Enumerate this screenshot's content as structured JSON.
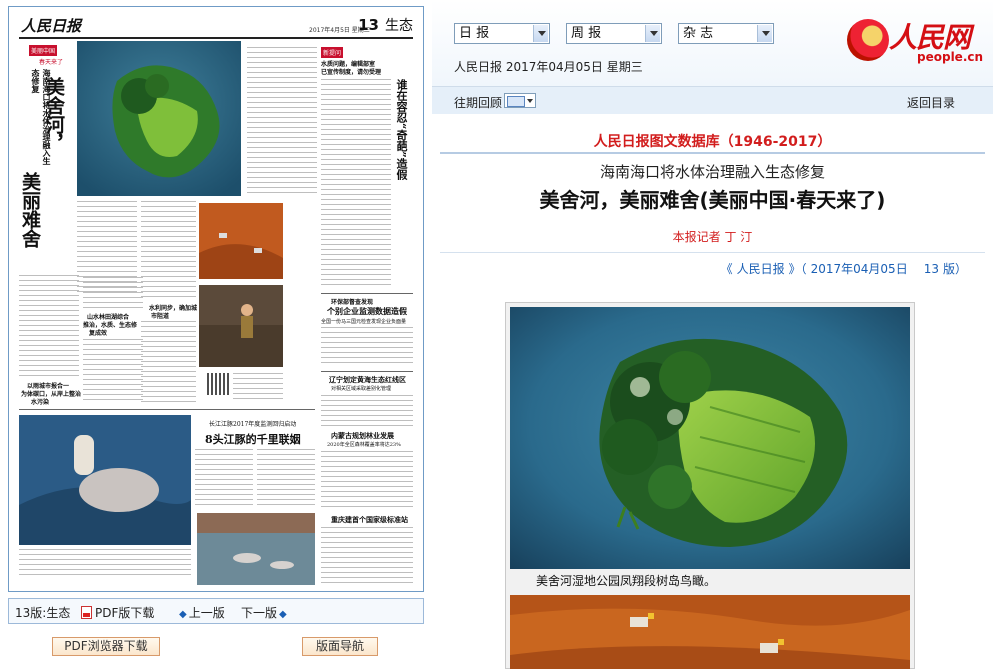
{
  "left": {
    "paper": {
      "logo": "人民日报",
      "date_line": "2017年4月5日 星期三",
      "page_no": "13",
      "section": "生态",
      "tag_top": "美丽中国",
      "tag_sub": "春天来了",
      "kicker": "海南海口将水体治理融入生态修复",
      "headline_v1": "美舍河，",
      "headline_v2": "美丽难舍",
      "right_col_tag": "新提问",
      "right_vhead": "谁在容忍“奇葩”造假",
      "sub1": "水质问题，编辑部室",
      "sub2": "已宣传制度，请勿受理",
      "mid_tag": "环保部督查发现",
      "mid_h": "个别企业监测数据造假",
      "mid_sub": "全国一份马三国元检查发现企业负面量",
      "liaoning_h": "辽宁划定黄海生态红线区",
      "liaoning_sub": "对相关区域采取差别化管理",
      "river_h1": "水利同步，确加城",
      "river_h2": "市阻道",
      "dolphin_kicker": "长江江豚2017年度监测回归启动",
      "dolphin_h": "8头江豚的千里联姻",
      "nm_h": "内蒙古规划林业发展",
      "nm_sub": "2020年全区森林覆盖率将达23%",
      "cq_h": "重庆建首个国家级标准站",
      "left_h1": "以雨城市报合一",
      "left_h2": "为体碳口，从岸上整治",
      "left_h3": "水污染",
      "left_h4": "山水林田湖综合",
      "left_h5": "推治，水质、生态修",
      "left_h6": "复成效"
    },
    "toolbar": {
      "page_label": "13版:生态",
      "pdf_label": "PDF版下载",
      "prev_label": "上一版",
      "next_label": "下一版"
    },
    "buttons": {
      "pdf_browser": "PDF浏览器下载",
      "page_nav": "版面导航"
    }
  },
  "right": {
    "selects": {
      "daily": "日 报",
      "weekly": "周 报",
      "magazine": "杂 志"
    },
    "pub_line": "人民日报 2017年04月05日 星期三",
    "logo": {
      "cn": "人民网",
      "en": "people.cn"
    },
    "nav": {
      "past_label": "往期回顾",
      "back_label": "返回目录"
    },
    "article": {
      "db_title": "人民日报图文数据库（1946-2017）",
      "subtitle": "海南海口将水体治理融入生态修复",
      "headline": "美舍河，美丽难舍(美丽中国·春天来了)",
      "byline": "本报记者 丁 汀",
      "source": {
        "open": "《",
        "paper": "人民日报",
        "close": "》（",
        "date": "2017年04月05日",
        "page": "13",
        "page_suffix": "版）"
      },
      "caption": "美舍河湿地公园凤翔段树岛鸟瞰。"
    }
  },
  "colors": {
    "accent_red": "#d21d1d",
    "link_blue": "#1a5fb4",
    "frame_blue": "#6f9bc6"
  }
}
